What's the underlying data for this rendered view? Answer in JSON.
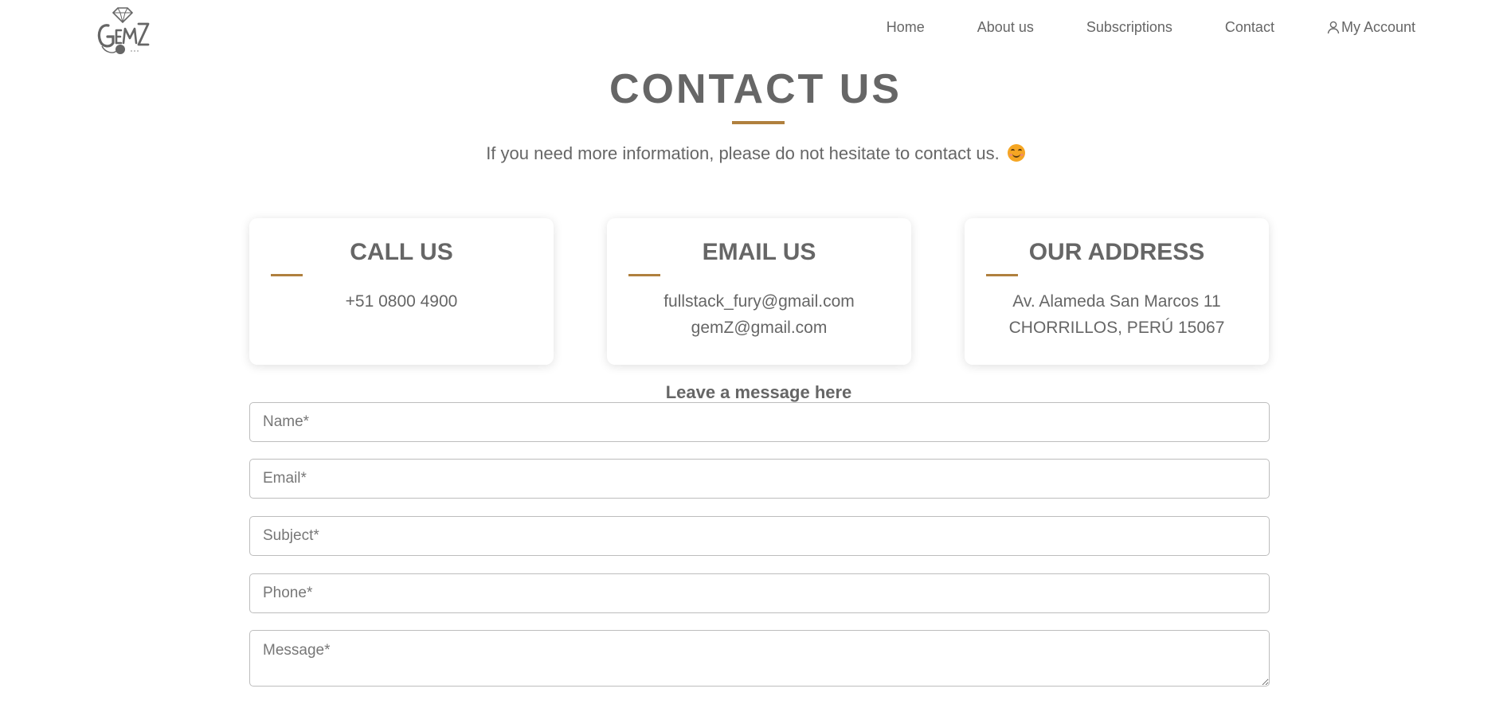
{
  "header": {
    "logo_alt": "GEMZ",
    "nav": [
      {
        "label": "Home"
      },
      {
        "label": "About us"
      },
      {
        "label": "Subscriptions"
      },
      {
        "label": "Contact"
      },
      {
        "label": "My Account",
        "icon": "user-icon"
      }
    ]
  },
  "main": {
    "title": "CONTACT US",
    "subtitle": "If you need more information, please do not hesitate to contact us.",
    "subtitle_emoji": "smiling-face-icon",
    "accent_color": "#b0803e",
    "cards": [
      {
        "title": "CALL US",
        "lines": [
          "+51 0800 4900"
        ]
      },
      {
        "title": "EMAIL US",
        "lines": [
          "fullstack_fury@gmail.com",
          "gemZ@gmail.com"
        ]
      },
      {
        "title": "OUR ADDRESS",
        "lines": [
          "Av. Alameda San Marcos 11",
          "CHORRILLOS, PERÚ 15067"
        ]
      }
    ]
  },
  "form": {
    "heading": "Leave a message here",
    "name_placeholder": "Name*",
    "email_placeholder": "Email*",
    "subject_placeholder": "Subject*",
    "phone_placeholder": "Phone*",
    "message_placeholder": "Message*"
  }
}
